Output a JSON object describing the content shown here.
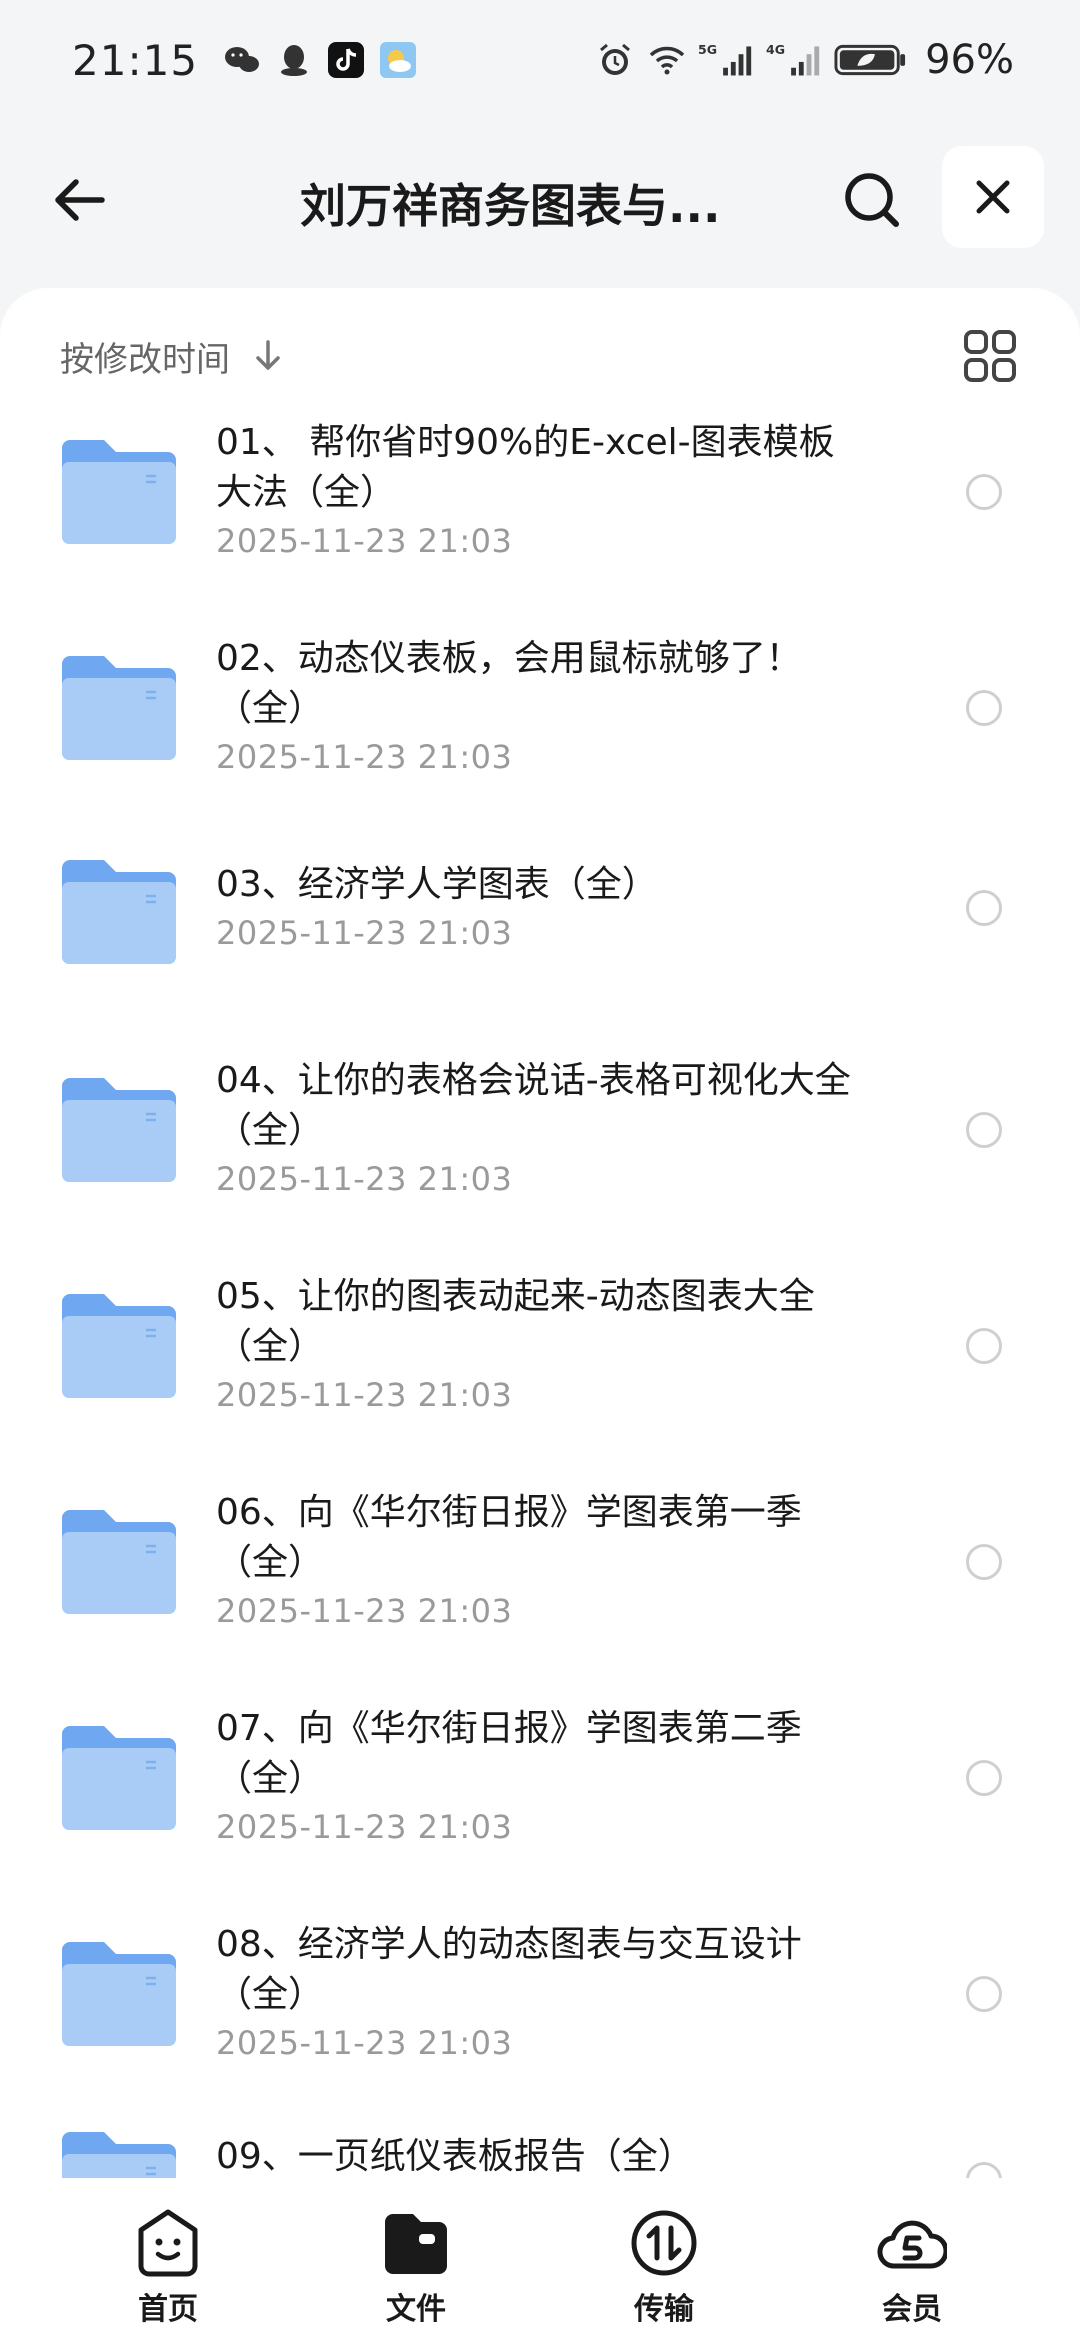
{
  "status_bar": {
    "time": "21:15",
    "battery": "96%",
    "left_icons": [
      "wechat-icon",
      "qq-icon",
      "tiktok-icon",
      "weather-icon"
    ],
    "right_icons": [
      "alarm-icon",
      "wifi-icon",
      "signal-5g-icon",
      "signal-4g-icon",
      "battery-icon"
    ]
  },
  "header": {
    "title": "刘万祥商务图表与..."
  },
  "toolbar": {
    "sort_label": "按修改时间"
  },
  "files": [
    {
      "name": "01、 帮你省时90%的E-xcel-图表模板大法（全）",
      "date": "2025-11-23 21:03"
    },
    {
      "name": "02、动态仪表板，会用鼠标就够了！（全）",
      "date": "2025-11-23 21:03"
    },
    {
      "name": "03、经济学人学图表（全）",
      "date": "2025-11-23 21:03"
    },
    {
      "name": "04、让你的表格会说话-表格可视化大全（全）",
      "date": "2025-11-23 21:03"
    },
    {
      "name": "05、让你的图表动起来-动态图表大全（全）",
      "date": "2025-11-23 21:03"
    },
    {
      "name": "06、向《华尔街日报》学图表第一季（全）",
      "date": "2025-11-23 21:03"
    },
    {
      "name": "07、向《华尔街日报》学图表第二季（全）",
      "date": "2025-11-23 21:03"
    },
    {
      "name": "08、经济学人的动态图表与交互设计（全）",
      "date": "2025-11-23 21:03"
    },
    {
      "name": "09、一页纸仪表板报告（全）",
      "date": ""
    }
  ],
  "nav": [
    {
      "label": "首页",
      "icon": "home-face-icon"
    },
    {
      "label": "文件",
      "icon": "folder-file-icon"
    },
    {
      "label": "传输",
      "icon": "transfer-icon"
    },
    {
      "label": "会员",
      "icon": "vip-cloud-icon"
    }
  ],
  "colors": {
    "folder": "#6fa8f0",
    "folder_light": "#a9ccf7",
    "date": "#9a9a9a"
  }
}
